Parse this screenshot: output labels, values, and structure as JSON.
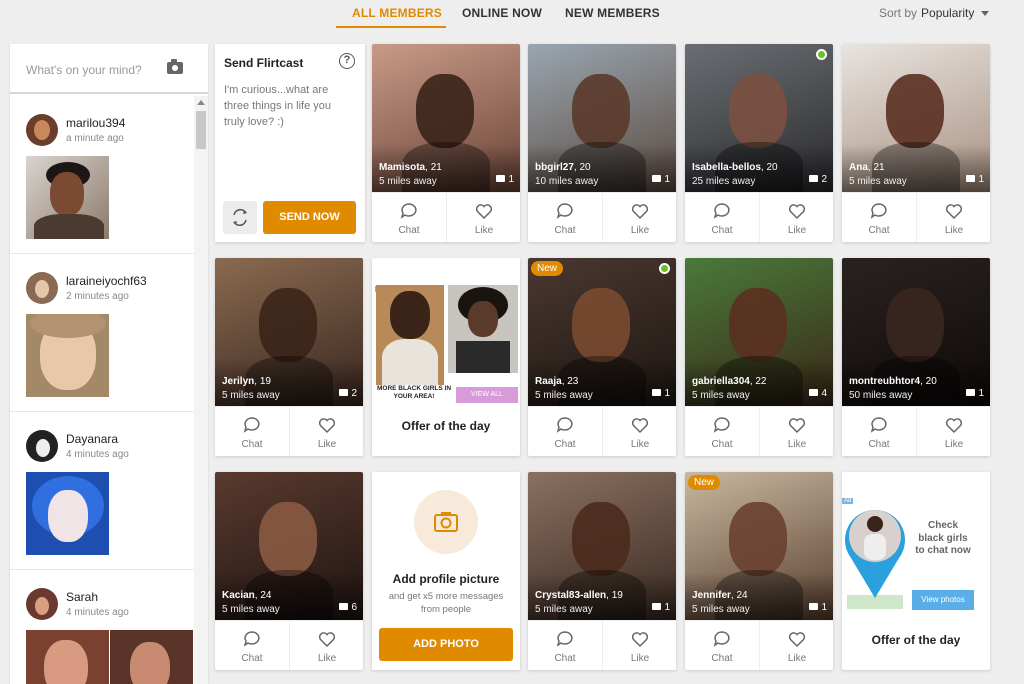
{
  "tabs": [
    {
      "label": "ALL MEMBERS",
      "active": true
    },
    {
      "label": "ONLINE NOW",
      "active": false
    },
    {
      "label": "NEW MEMBERS",
      "active": false
    }
  ],
  "sort": {
    "label": "Sort by",
    "value": "Popularity"
  },
  "feed": {
    "placeholder": "What's on your mind?",
    "posts": [
      {
        "name": "marilou394",
        "time": "a minute ago"
      },
      {
        "name": "laraineiyochf63",
        "time": "2 minutes ago"
      },
      {
        "name": "Dayanara",
        "time": "4 minutes ago"
      },
      {
        "name": "Sarah",
        "time": "4 minutes ago"
      }
    ]
  },
  "flirtcast": {
    "title": "Send Flirtcast",
    "message": "I'm curious...what are three things in life you truly love? :)",
    "send_label": "SEND NOW"
  },
  "labels": {
    "chat": "Chat",
    "like": "Like",
    "new": "New",
    "ad": "Ad"
  },
  "members": [
    {
      "name": "Mamisota",
      "age": "21",
      "distance": "5 miles away",
      "photos": "1"
    },
    {
      "name": "bbgirl27",
      "age": "20",
      "distance": "10 miles away",
      "photos": "1"
    },
    {
      "name": "Isabella-bellos",
      "age": "20",
      "distance": "25 miles away",
      "photos": "2"
    },
    {
      "name": "Ana",
      "age": "21",
      "distance": "5 miles away",
      "photos": "1"
    },
    {
      "name": "Jerilyn",
      "age": "19",
      "distance": "5 miles away",
      "photos": "2"
    },
    {
      "name": "Raaja",
      "age": "23",
      "distance": "5 miles away",
      "photos": "1"
    },
    {
      "name": "gabriella304",
      "age": "22",
      "distance": "5 miles away",
      "photos": "4"
    },
    {
      "name": "montreubhtor4",
      "age": "20",
      "distance": "50 miles away",
      "photos": "1"
    },
    {
      "name": "Kacian",
      "age": "24",
      "distance": "5 miles away",
      "photos": "6"
    },
    {
      "name": "Crystal83-allen",
      "age": "19",
      "distance": "5 miles away",
      "photos": "1"
    },
    {
      "name": "Jennifer",
      "age": "24",
      "distance": "5 miles away",
      "photos": "1"
    }
  ],
  "ad1": {
    "banner_text": "MORE BLACK GIRLS IN YOUR AREA!",
    "button": "VIEW ALL",
    "caption": "Offer of the day"
  },
  "ad2": {
    "text": "Check black girls to chat now",
    "button": "View photos",
    "caption": "Offer of the day"
  },
  "add_photo": {
    "title": "Add profile picture",
    "subtitle": "and get x5 more messages from people",
    "button": "ADD PHOTO"
  },
  "colors": {
    "accent": "#e08a00",
    "online": "#6cbe2c"
  }
}
